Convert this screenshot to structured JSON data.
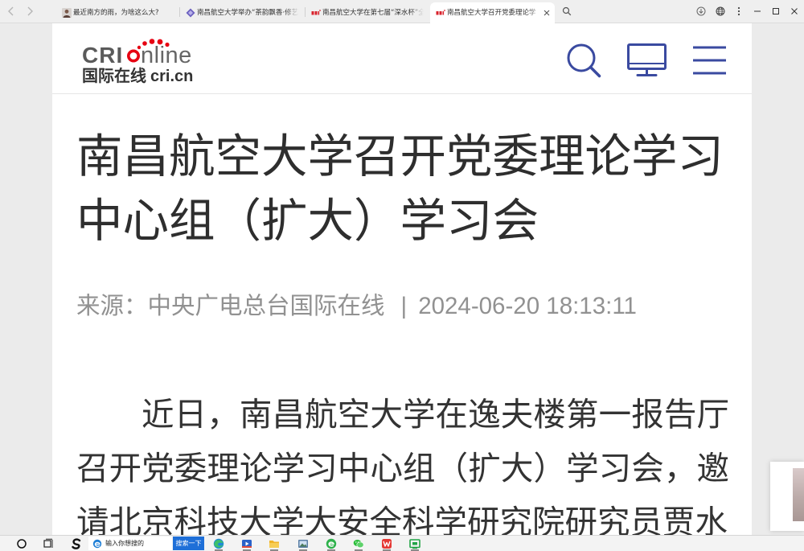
{
  "browser": {
    "tabs": [
      {
        "title": "最近南方的雨，为啥这么大?",
        "active": false
      },
      {
        "title": "南昌航空大学举办“茶韵飘香·修艺",
        "active": false
      },
      {
        "title": "南昌航空大学在第七届“深水杯”全",
        "active": false
      },
      {
        "title": "南昌航空大学召开党委理论学",
        "active": true
      }
    ],
    "tab_icons": [
      "avatar-icon",
      "diamond-icon",
      "cri-favicon-icon",
      "cri-favicon-icon"
    ],
    "toolbar_icons": [
      "chevron-left-icon",
      "chevron-right-icon",
      "search-icon",
      "download-icon",
      "globe-icon",
      "more-vertical-icon",
      "minimize-icon",
      "maximize-icon",
      "close-icon"
    ]
  },
  "site": {
    "logo": {
      "mark_left": "CRI",
      "mark_right": "nline",
      "cn_name": "国际在线",
      "domain": "cri.cn"
    },
    "header_icons": [
      "search-icon",
      "monitor-icon",
      "menu-icon"
    ],
    "colors": {
      "accent": "#3a4aa0",
      "logo_red": "#e60012",
      "page_bg": "#ebebeb"
    }
  },
  "article": {
    "title": "南昌航空大学召开党委理论学习中心组（扩大）学习会",
    "source_label": "来源：",
    "source": "中央广电总台国际在线",
    "separator": "|",
    "datetime": "2024-06-20 18:13:11",
    "body": "近日，南昌航空大学在逸夫楼第一报告厅召开党委理论学习中心组（扩大）学习会，邀请北京科技大学大安全科学研究院研究员贾水"
  },
  "taskbar": {
    "search_placeholder": "输入你想搜的",
    "search_button": "搜索一下",
    "app_icons": [
      "cortana-search-icon",
      "task-view-icon",
      "app-icon",
      "edge-icon",
      "media-player-icon",
      "folder-icon",
      "photos-icon",
      "360-browser-icon",
      "wechat-icon",
      "wps-icon",
      "green-app-icon"
    ],
    "colors": {
      "search_button": "#1e6fd8"
    }
  }
}
